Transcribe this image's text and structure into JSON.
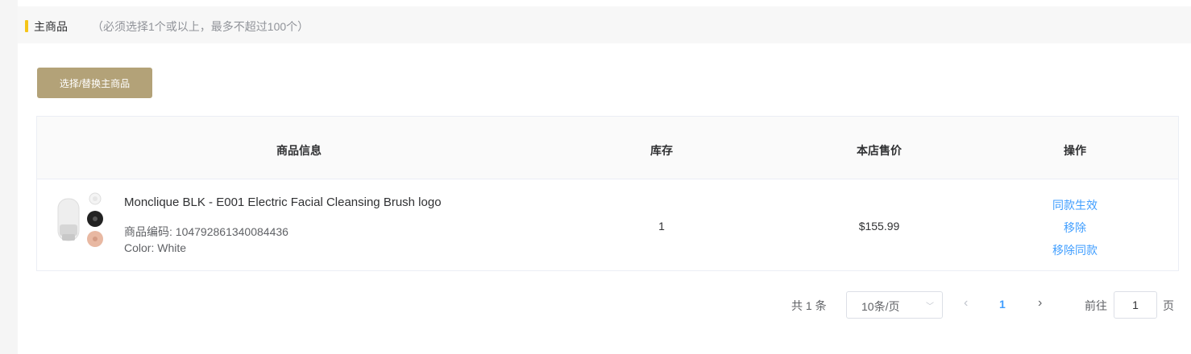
{
  "section": {
    "title": "主商品",
    "hint": "（必须选择1个或以上，最多不超过100个）",
    "accent_color": "#f5c518"
  },
  "select_button": {
    "label": "选择/替换主商品",
    "color": "#b3a278"
  },
  "table": {
    "headers": {
      "info": "商品信息",
      "stock": "库存",
      "price": "本店售价",
      "ops": "操作"
    },
    "rows": [
      {
        "name": "Monclique BLK - E001 Electric Facial Cleansing Brush logo",
        "code": "商品编码: 104792861340084436",
        "color": "Color: White",
        "stock": "1",
        "price": "$155.99",
        "thumbnail_icon": "facial-brush-product-image",
        "ops": [
          "同款生效",
          "移除",
          "移除同款"
        ]
      }
    ]
  },
  "pagination": {
    "total": "共 1 条",
    "page_size": "10条/页",
    "current_page": "1",
    "goto_prefix": "前往",
    "goto_value": "1",
    "goto_suffix": "页",
    "link_color": "#409eff"
  }
}
